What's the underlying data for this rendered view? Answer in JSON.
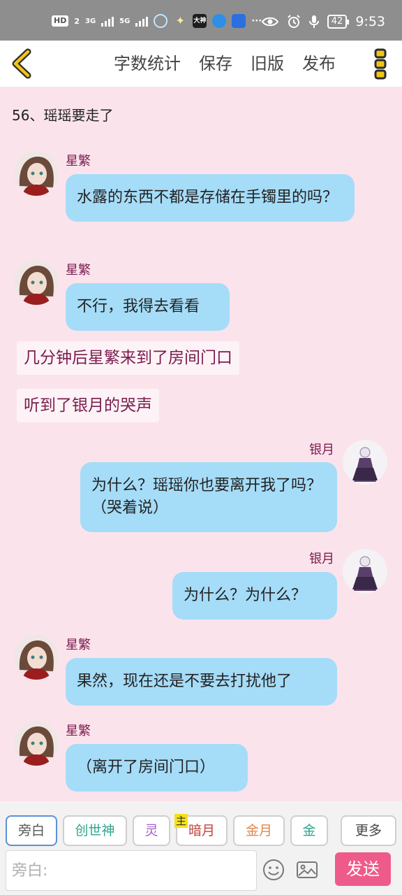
{
  "status_bar": {
    "hd": "HD",
    "sim": "2",
    "net1": "3G",
    "net2": "5G",
    "app_dashen": "大神",
    "more": "···",
    "battery": "42",
    "time": "9:53"
  },
  "header": {
    "actions": [
      "字数统计",
      "保存",
      "旧版",
      "发布"
    ]
  },
  "chapter_title": "56、瑶瑶要走了",
  "messages": [
    {
      "name": "星繁",
      "text": "水露的东西不都是存储在手镯里的吗？"
    },
    {
      "name": "星繁",
      "text": "不行，我得去看看"
    },
    {
      "narration": "几分钟后星繁来到了房间门口"
    },
    {
      "narration": "听到了银月的哭声"
    },
    {
      "name": "银月",
      "text": "为什么？瑶瑶你也要离开我了吗？（哭着说）"
    },
    {
      "name": "银月",
      "text": "为什么？为什么？"
    },
    {
      "name": "星繁",
      "text": "果然，现在还是不要去打扰他了"
    },
    {
      "name": "星繁",
      "text": "（离开了房间门口）"
    }
  ],
  "roles": [
    {
      "label": "旁白",
      "color": "#555555"
    },
    {
      "label": "创世神",
      "color": "#2fa58e"
    },
    {
      "label": "灵",
      "color": "#a45ec4"
    },
    {
      "label": "暗月",
      "color": "#c0433c",
      "badge": "主"
    },
    {
      "label": "金月",
      "color": "#e0884a"
    },
    {
      "label": "金",
      "color": "#2fa58e"
    },
    {
      "label": "更多",
      "color": "#444444"
    }
  ],
  "input": {
    "placeholder": "旁白:"
  },
  "send_label": "发送"
}
